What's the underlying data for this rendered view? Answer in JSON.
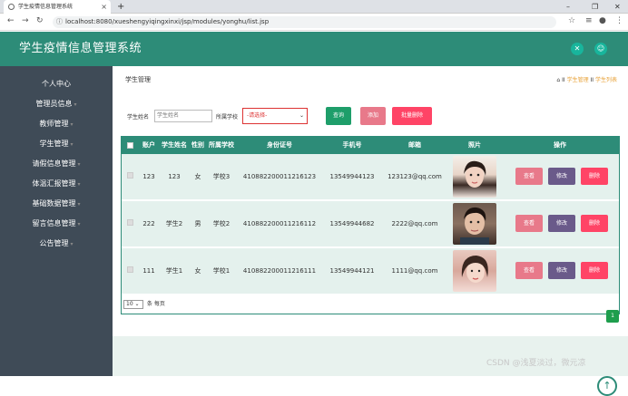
{
  "browser": {
    "tab_title": "学生疫情信息管理系统",
    "tab_close": "×",
    "new_tab": "+",
    "url": "localhost:8080/xueshengyiqingxinxi/jsp/modules/yonghu/list.jsp",
    "controls": {
      "minimize": "–",
      "restore": "❐",
      "close": "✕"
    }
  },
  "header": {
    "title": "学生疫情信息管理系统",
    "icons": [
      "shrink-icon",
      "user-icon"
    ]
  },
  "sidebar": {
    "items": [
      {
        "label": "个人中心",
        "caret": false
      },
      {
        "label": "管理员信息",
        "caret": true
      },
      {
        "label": "教师管理",
        "caret": true
      },
      {
        "label": "学生管理",
        "caret": true
      },
      {
        "label": "请假信息管理",
        "caret": true
      },
      {
        "label": "体温汇报管理",
        "caret": true
      },
      {
        "label": "基础数据管理",
        "caret": true
      },
      {
        "label": "留言信息管理",
        "caret": true
      },
      {
        "label": "公告管理",
        "caret": true
      }
    ]
  },
  "page": {
    "title": "学生管理",
    "breadcrumb": {
      "home": "学生管理",
      "sep": "II",
      "current": "学生列表"
    }
  },
  "filters": {
    "name_label": "学生姓名",
    "name_placeholder": "学生姓名",
    "school_label": "所属学校",
    "school_value": "-请选择-",
    "search_button": "查询",
    "add_button": "添加",
    "batch_delete_button": "批量删除"
  },
  "table": {
    "headers": [
      "账户",
      "学生姓名",
      "性别",
      "所属学校",
      "身份证号",
      "手机号",
      "邮箱",
      "照片",
      "操作"
    ],
    "rows": [
      {
        "account": "123",
        "name": "123",
        "gender": "女",
        "school": "学校3",
        "id_card": "410882200011216123",
        "phone": "13549944123",
        "email": "123123@qq.com"
      },
      {
        "account": "222",
        "name": "学生2",
        "gender": "男",
        "school": "学校2",
        "id_card": "410882200011216112",
        "phone": "13549944682",
        "email": "2222@qq.com"
      },
      {
        "account": "111",
        "name": "学生1",
        "gender": "女",
        "school": "学校1",
        "id_card": "410882200011216111",
        "phone": "13549944121",
        "email": "1111@qq.com"
      }
    ],
    "actions": {
      "view": "查看",
      "edit": "修改",
      "delete": "删除"
    }
  },
  "pagination": {
    "page_size": "10",
    "per_page_label": "条 每页",
    "current_page": "1"
  },
  "watermark": "CSDN @浅夏淡过，微元凉",
  "colors": {
    "header": "#2d8c78",
    "sidebar": "#3f4b57",
    "search": "#1e9e6a",
    "add": "#e8798a",
    "delete": "#ff4466",
    "view": "#e8798a",
    "edit": "#6a5a8a"
  }
}
